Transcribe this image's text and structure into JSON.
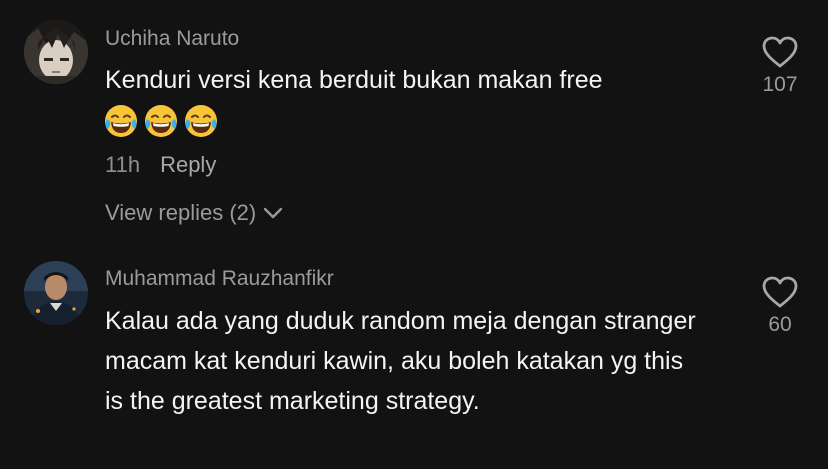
{
  "comments": [
    {
      "username": "Uchiha Naruto",
      "text": "Kenduri versi kena berduit bukan makan free",
      "emojis": [
        "laughing-tears",
        "laughing-tears",
        "laughing-tears"
      ],
      "time": "11h",
      "reply_label": "Reply",
      "view_replies": "View replies (2)",
      "likes": "107"
    },
    {
      "username": "Muhammad Rauzhanfikr",
      "text": "Kalau ada yang duduk random meja dengan stranger macam kat kenduri kawin, aku boleh katakan yg this is the greatest marketing strategy.",
      "likes": "60"
    }
  ],
  "icons": {
    "like": "heart-outline-icon",
    "expand": "chevron-down-icon"
  },
  "colors": {
    "background": "#121212",
    "text": "#f4f4f4",
    "secondary": "#9b9b9b",
    "emoji_face": "#f7c43a"
  }
}
